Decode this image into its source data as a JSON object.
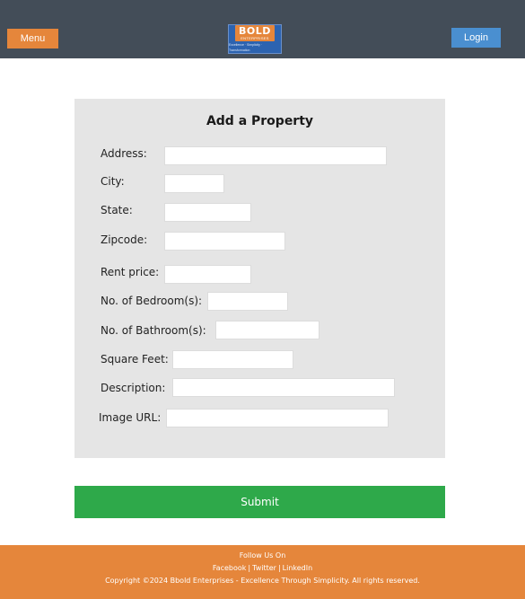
{
  "header": {
    "menu_label": "Menu",
    "login_label": "Login",
    "logo": {
      "main": "BOLD",
      "sub": "ENTERPRISES",
      "tagline": "Excellence · Simplicity · Transformation"
    }
  },
  "form": {
    "title": "Add a Property",
    "fields": {
      "address": {
        "label": "Address:",
        "value": ""
      },
      "city": {
        "label": "City:",
        "value": ""
      },
      "state": {
        "label": "State:",
        "value": ""
      },
      "zipcode": {
        "label": "Zipcode:",
        "value": ""
      },
      "rent_price": {
        "label": "Rent price:",
        "value": ""
      },
      "bedrooms": {
        "label": "No. of Bedroom(s):",
        "value": ""
      },
      "bathrooms": {
        "label": "No. of Bathroom(s):",
        "value": ""
      },
      "square_feet": {
        "label": "Square Feet:",
        "value": ""
      },
      "description": {
        "label": "Description:",
        "value": ""
      },
      "image_url": {
        "label": "Image URL:",
        "value": ""
      }
    },
    "submit_label": "Submit"
  },
  "footer": {
    "follow_label": "Follow Us On",
    "links": [
      "Facebook",
      "Twitter",
      "LinkedIn"
    ],
    "separator": "|",
    "copyright": "Copyright ©2024 Bbold Enterprises - Excellence Through Simplicity. All rights reserved."
  },
  "colors": {
    "header_bg": "#434d58",
    "accent_orange": "#e5863b",
    "login_blue": "#4a8fd0",
    "submit_green": "#2ea94a",
    "panel_bg": "#e5e5e5"
  }
}
